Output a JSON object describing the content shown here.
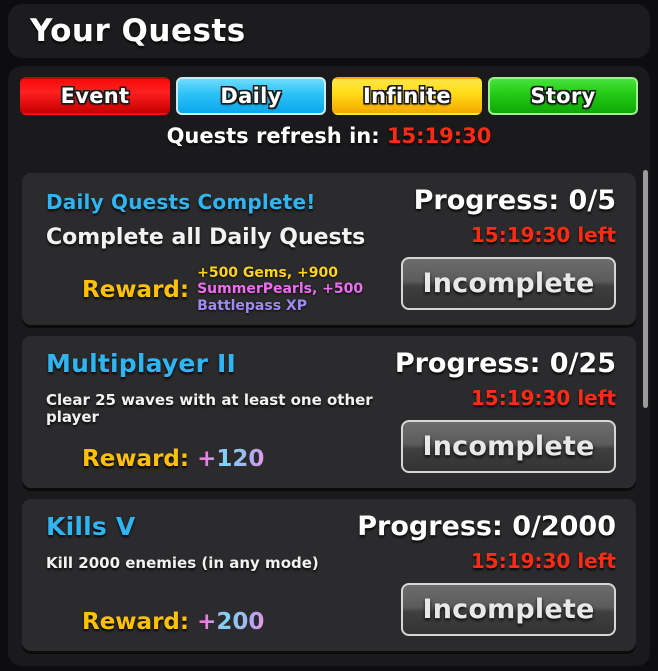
{
  "header": {
    "title": "Your Quests"
  },
  "tabs": [
    {
      "label": "Event",
      "color": "#f60b0b",
      "selected": false
    },
    {
      "label": "Daily",
      "color": "#2fc3f7",
      "selected": true
    },
    {
      "label": "Infinite",
      "color": "#ffdd18",
      "selected": false
    },
    {
      "label": "Story",
      "color": "#24cc17",
      "selected": true
    }
  ],
  "refresh": {
    "label": "Quests refresh in:",
    "time": "15:19:30"
  },
  "quests": [
    {
      "title": "Daily Quests Complete!",
      "description": "Complete all Daily Quests",
      "reward_label": "Reward:",
      "reward_parts": [
        {
          "text": "+500 Gems, +900",
          "color": "#ffd21e"
        },
        {
          "text": "SummerPearls, +500",
          "color": "#ef6df0"
        },
        {
          "text": "Battlepass XP",
          "color": "#a08bf5"
        }
      ],
      "progress": "Progress: 0/5",
      "time_left": "15:19:30 left",
      "status": "Incomplete"
    },
    {
      "title": "Multiplayer II",
      "description": "Clear 25 waves with at least one other player",
      "reward_label": "Reward:",
      "reward_value": "+120",
      "progress": "Progress: 0/25",
      "time_left": "15:19:30 left",
      "status": "Incomplete"
    },
    {
      "title": "Kills V",
      "description": "Kill 2000 enemies (in any mode)",
      "reward_label": "Reward:",
      "reward_value": "+200",
      "progress": "Progress: 0/2000",
      "time_left": "15:19:30 left",
      "status": "Incomplete"
    }
  ],
  "colors": {
    "quest_title": "#2fb5f2",
    "timer_red": "#ff2b16",
    "reward_gold": "#ffc107",
    "panel_bg": "#1a1a1c",
    "card_bg": "#2b2b2d"
  }
}
